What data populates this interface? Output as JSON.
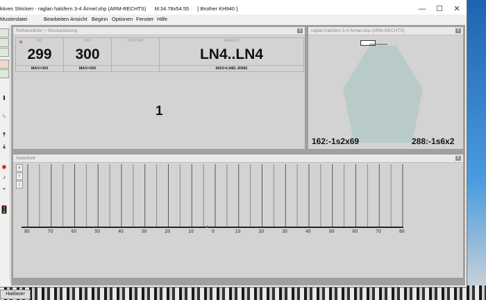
{
  "window": {
    "title_part1": "ktives Stricken - raglan halsfern 3-4 Ärmel.shp (ARM-RECHTS)",
    "title_part2": "M:34.78x54.55",
    "title_part3": "[ Brother KH940 ]",
    "minimize": "—",
    "maximize": "☐",
    "close": "✕"
  },
  "menu": [
    "Musterdatei",
    "Bearbeiten",
    "Ansicht",
    "Beginn",
    "Optionen",
    "Fenster",
    "Hilfe"
  ],
  "counter_window": {
    "caption": "Reihenzähler + Strickanleitung",
    "close": "x",
    "rz_header": "RZ",
    "rz_value": "299",
    "rz_max": "MAX=300",
    "teil_header": "TEIL",
    "teil_value": "300",
    "teil_max": "MAX=300",
    "muster_header": "MUSTER",
    "nadeln_header": "NADELN",
    "nadeln_value": "LN4..LN4",
    "nadeln_max": "MAX=LN82..RN82",
    "instruction": "1"
  },
  "shape_window": {
    "caption": "raglan halsfern 3-4 Ärmel.shp (ARM-RECHTS)",
    "close": "x",
    "left_label": "162:-1s2x69",
    "right_label": "288:-1s6x2"
  },
  "needle_window": {
    "caption": "Nadelbett",
    "close": "x",
    "ruler_labels": [
      "80",
      "70",
      "60",
      "50",
      "40",
      "30",
      "20",
      "10",
      "0",
      "10",
      "20",
      "30",
      "40",
      "50",
      "60",
      "70",
      "80"
    ]
  },
  "taskbar": {
    "label": "Haitlaser"
  },
  "colors": {
    "shape_fill": "#b9cbc9",
    "panel_bg": "#d3d3d3"
  }
}
